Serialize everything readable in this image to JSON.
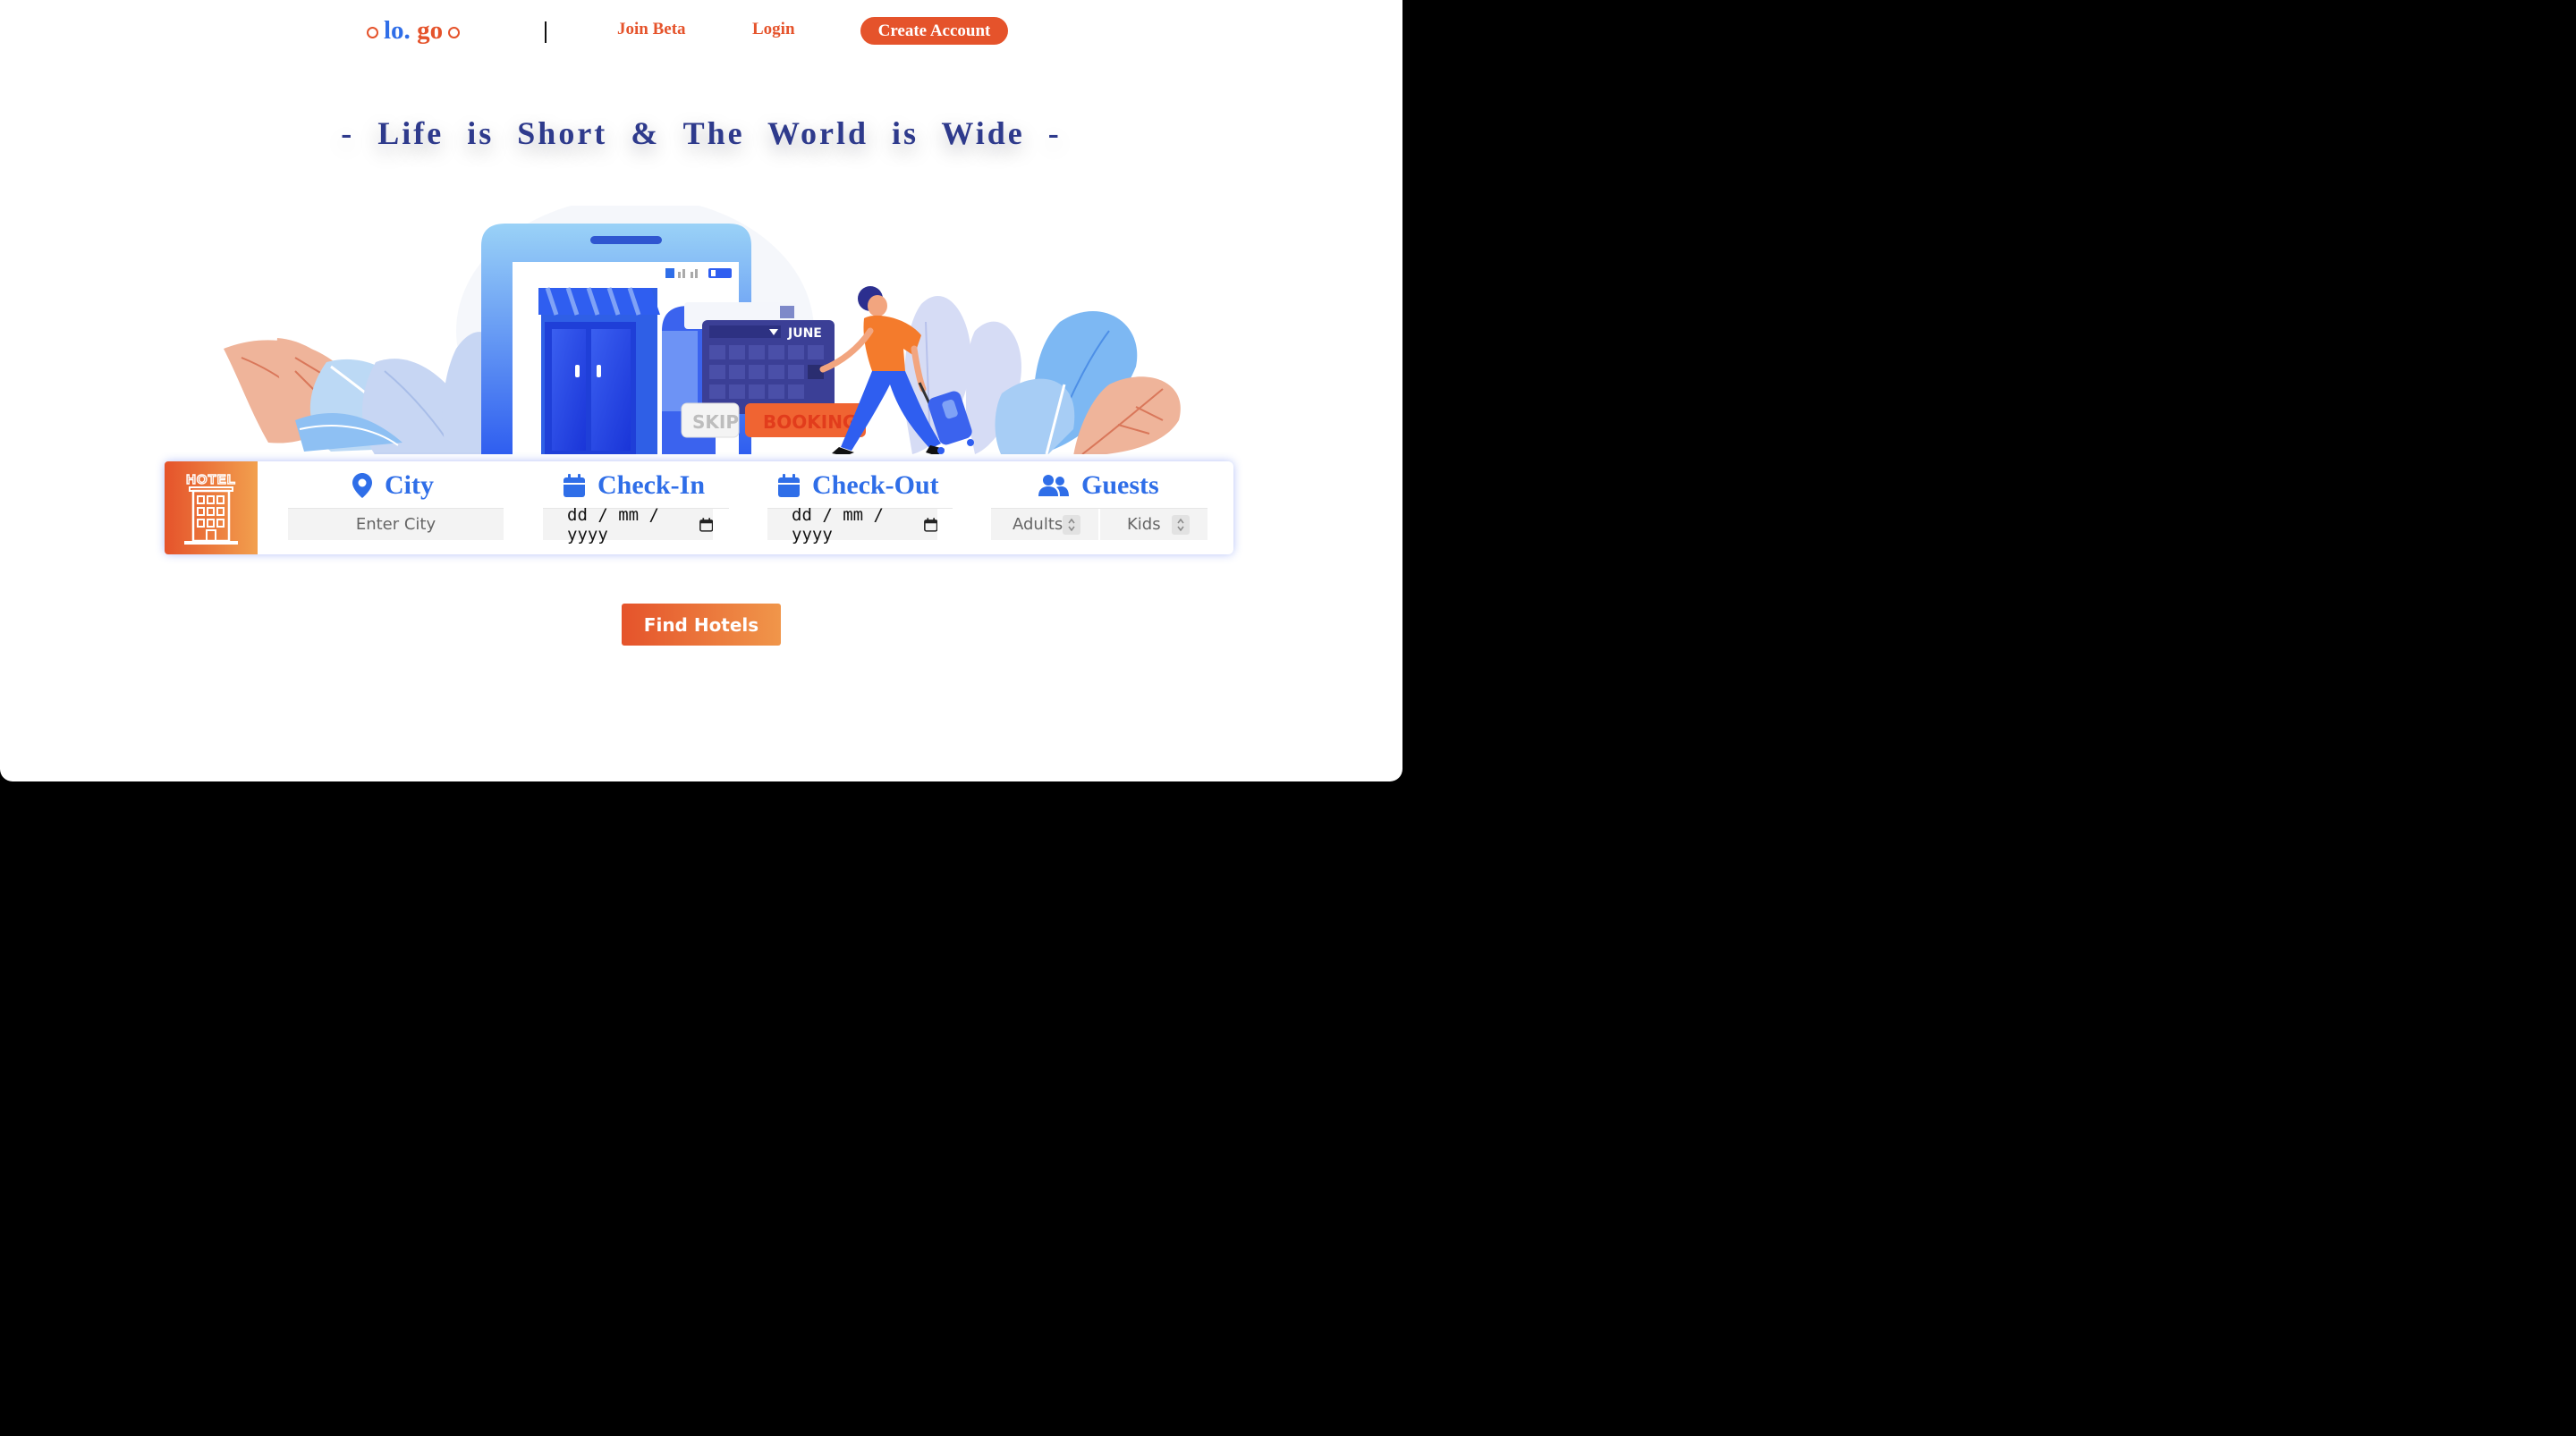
{
  "nav": {
    "logo_left": "lo.",
    "logo_right": "go",
    "join_beta": "Join Beta",
    "login": "Login",
    "create_account": "Create Account"
  },
  "hero": {
    "tagline": "- Life is Short & The World is Wide -",
    "calendar_month": "JUNE",
    "skip_label": "SKIP",
    "booking_label": "BOOKING",
    "hotel_sign": "HOTEL"
  },
  "search": {
    "city_label": "City",
    "city_placeholder": "Enter City",
    "checkin_label": "Check-In",
    "checkin_value": "dd / mm / yyyy",
    "checkout_label": "Check-Out",
    "checkout_value": "dd / mm / yyyy",
    "guests_label": "Guests",
    "adults_placeholder": "Adults",
    "kids_placeholder": "Kids"
  },
  "actions": {
    "find_hotels": "Find Hotels"
  },
  "colors": {
    "accent_orange": "#e5532b",
    "accent_blue": "#2f6ee8",
    "tagline_navy": "#2e3a8c"
  },
  "icons": [
    "location-pin-icon",
    "calendar-icon",
    "users-icon",
    "hotel-building-icon"
  ]
}
